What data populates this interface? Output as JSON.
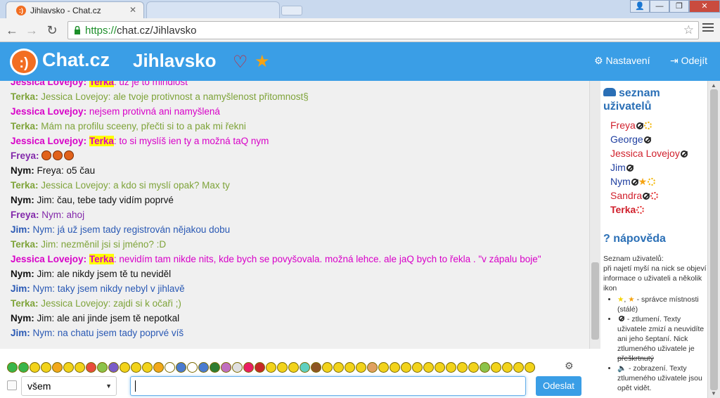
{
  "browser": {
    "tab_title": "Jihlavsko - Chat.cz",
    "tab_close": "✕",
    "url_protocol": "https://",
    "url_rest": "chat.cz/Jihlavsko",
    "window_buttons": [
      "👤",
      "—",
      "❐",
      "✕"
    ]
  },
  "header": {
    "logo_text": ":)",
    "brand": "Chat.cz",
    "room": "Jihlavsko",
    "settings_label": "Nastavení",
    "logout_label": "Odejít"
  },
  "messages": [
    {
      "nick": "Jessica Lovejoy:",
      "color": "jessica",
      "highlight": "Terka",
      "text": ": už je to mindlost"
    },
    {
      "nick": "Terka:",
      "color": "terka",
      "text": "Jessica Lovejoy: ale tvoje protivnost a namyšlenost přitomnost§"
    },
    {
      "nick": "Jessica Lovejoy:",
      "color": "jessica",
      "text": "nejsem protivná ani namyšlená"
    },
    {
      "nick": "Terka:",
      "color": "terka",
      "text": "Mám na profilu sceeny, přečti si to a pak mi řekni"
    },
    {
      "nick": "Jessica Lovejoy:",
      "color": "jessica",
      "highlight": "Terka",
      "text": ": to si myslíš ien ty a možná taQ nym"
    },
    {
      "nick": "Freya:",
      "color": "freya",
      "text": "",
      "emoticons": 3
    },
    {
      "nick": "Nym:",
      "color": "nym",
      "text": "Freya: o5 čau"
    },
    {
      "nick": "Terka:",
      "color": "terka",
      "text": "Jessica Lovejoy: a kdo si myslí opak? Max ty"
    },
    {
      "nick": "Nym:",
      "color": "nym",
      "text": "Jim: čau, tebe tady vidím poprvé"
    },
    {
      "nick": "Freya:",
      "color": "freya",
      "text": "Nym: ahoj"
    },
    {
      "nick": "Jim:",
      "color": "jim",
      "text": "Nym: já už jsem tady registrován nějakou dobu"
    },
    {
      "nick": "Terka:",
      "color": "terka",
      "text": "Jim: nezměnil jsi si jméno? :D"
    },
    {
      "nick": "Jessica Lovejoy:",
      "color": "jessica",
      "highlight": "Terka",
      "text": ": nevidím tam nikde nits, kde bych se povyšovala. možná lehce. ale jaQ bych to řekla . \"v zápalu boje\""
    },
    {
      "nick": "Nym:",
      "color": "nym",
      "text": "Jim: ale nikdy jsem tě tu neviděl"
    },
    {
      "nick": "Jim:",
      "color": "jim",
      "text": "Nym: taky jsem nikdy nebyl v jihlavě"
    },
    {
      "nick": "Terka:",
      "color": "terka",
      "text": "Jessica Lovejoy: zajdi si k očaři ;)"
    },
    {
      "nick": "Nym:",
      "color": "nym",
      "text": "Jim: ale ani jinde jsem tě nepotkal"
    },
    {
      "nick": "Jim:",
      "color": "jim",
      "text": "Nym: na chatu jsem tady poprvé víš"
    }
  ],
  "sidebar": {
    "users_heading_1": "seznam",
    "users_heading_2": "uživatelů",
    "users": [
      {
        "name": "Freya",
        "color": "#d0202c",
        "icons": [
          "ban",
          "sun"
        ]
      },
      {
        "name": "George",
        "color": "#1f3fa0",
        "icons": [
          "ban"
        ]
      },
      {
        "name": "Jessica Lovejoy",
        "color": "#d0202c",
        "icons": [
          "ban"
        ]
      },
      {
        "name": "Jim",
        "color": "#1f3fa0",
        "icons": [
          "ban"
        ]
      },
      {
        "name": "Nym",
        "color": "#1f3fa0",
        "icons": [
          "ban",
          "star",
          "sun"
        ]
      },
      {
        "name": "Sandra",
        "color": "#d0202c",
        "icons": [
          "ban",
          "sunred"
        ]
      },
      {
        "name": "Terka",
        "color": "#d0202c",
        "bold": true,
        "icons": [
          "sunred"
        ]
      }
    ],
    "help_heading": "nápověda",
    "help_intro_1": "Seznam uživatelů:",
    "help_intro_2": "při najetí myší na nick se objeví informace o uživateli a několik ikon",
    "help_item_1": "- správce místnosti (stálé)",
    "help_item_2a": "- ztlumení. Texty uživatele zmizí a neuvidíte ani jeho šeptaní. Nick ztlumeného uživatele je",
    "help_item_2b": "přeškrtnutý",
    "help_item_3": "🔈 - zobrazení. Texty ztlumeného uživatele jsou opět vidět."
  },
  "input": {
    "recipient": "všem",
    "send_label": "Odeslat",
    "message_value": ""
  },
  "colors": {
    "header_blue": "#3a9ee6",
    "logo_orange": "#f26e22",
    "jessica": "#d800c8",
    "terka": "#7ea339",
    "jim": "#2a59b4",
    "freya": "#8228aa",
    "nym": "#111111"
  }
}
